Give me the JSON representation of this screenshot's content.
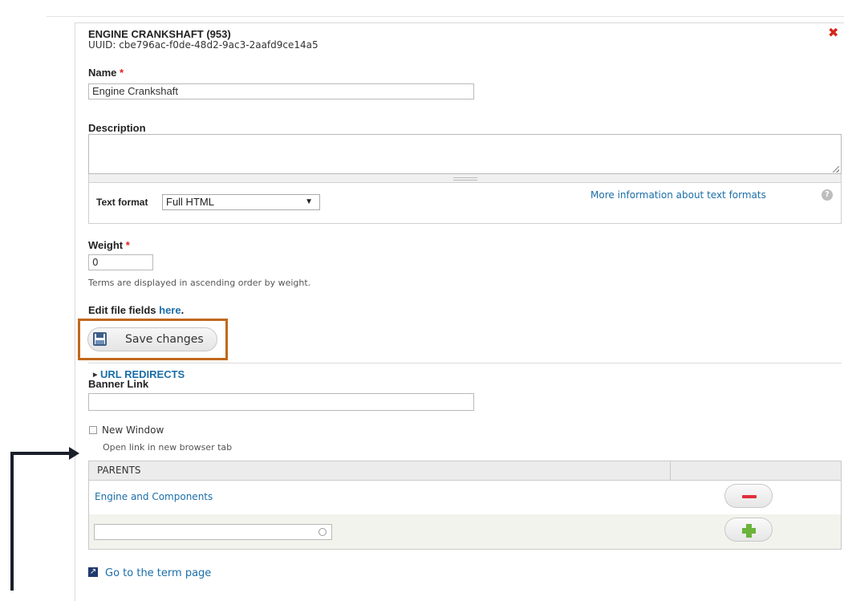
{
  "term": {
    "title": "ENGINE CRANKSHAFT (953)",
    "uuid": "UUID: cbe796ac-f0de-48d2-9ac3-2aafd9ce14a5"
  },
  "name_field": {
    "label": "Name",
    "required_mark": "*",
    "value": "Engine Crankshaft"
  },
  "description_field": {
    "label": "Description",
    "value": ""
  },
  "text_format": {
    "label": "Text format",
    "selected": "Full HTML",
    "more_info_link": "More information about text formats",
    "help_icon": "?"
  },
  "weight_field": {
    "label": "Weight",
    "required_mark": "*",
    "value": "0",
    "help": "Terms are displayed in ascending order by weight."
  },
  "edit_files": {
    "prefix": "Edit file fields",
    "link": "here",
    "suffix": "."
  },
  "save_button": {
    "label": "Save changes",
    "icon": "floppy-disk-icon"
  },
  "url_redirects": {
    "label": "URL REDIRECTS",
    "icon": "triangle-right-icon"
  },
  "banner_link": {
    "label": "Banner Link",
    "value": ""
  },
  "new_window": {
    "label": "New Window",
    "checked": false,
    "help": "Open link in new browser tab"
  },
  "parents_table": {
    "header": "PARENTS",
    "rows": [
      {
        "name": "Engine and Components",
        "action": "remove"
      }
    ],
    "new_row": {
      "value": "",
      "action": "add"
    }
  },
  "goto_link": {
    "label": "Go to the term page",
    "icon": "external-link-icon"
  },
  "colors": {
    "link": "#1b6ea9",
    "required": "#e31d1d",
    "highlight_outline": "#c0681d",
    "remove": "#e0303b",
    "add": "#6bb33b"
  }
}
